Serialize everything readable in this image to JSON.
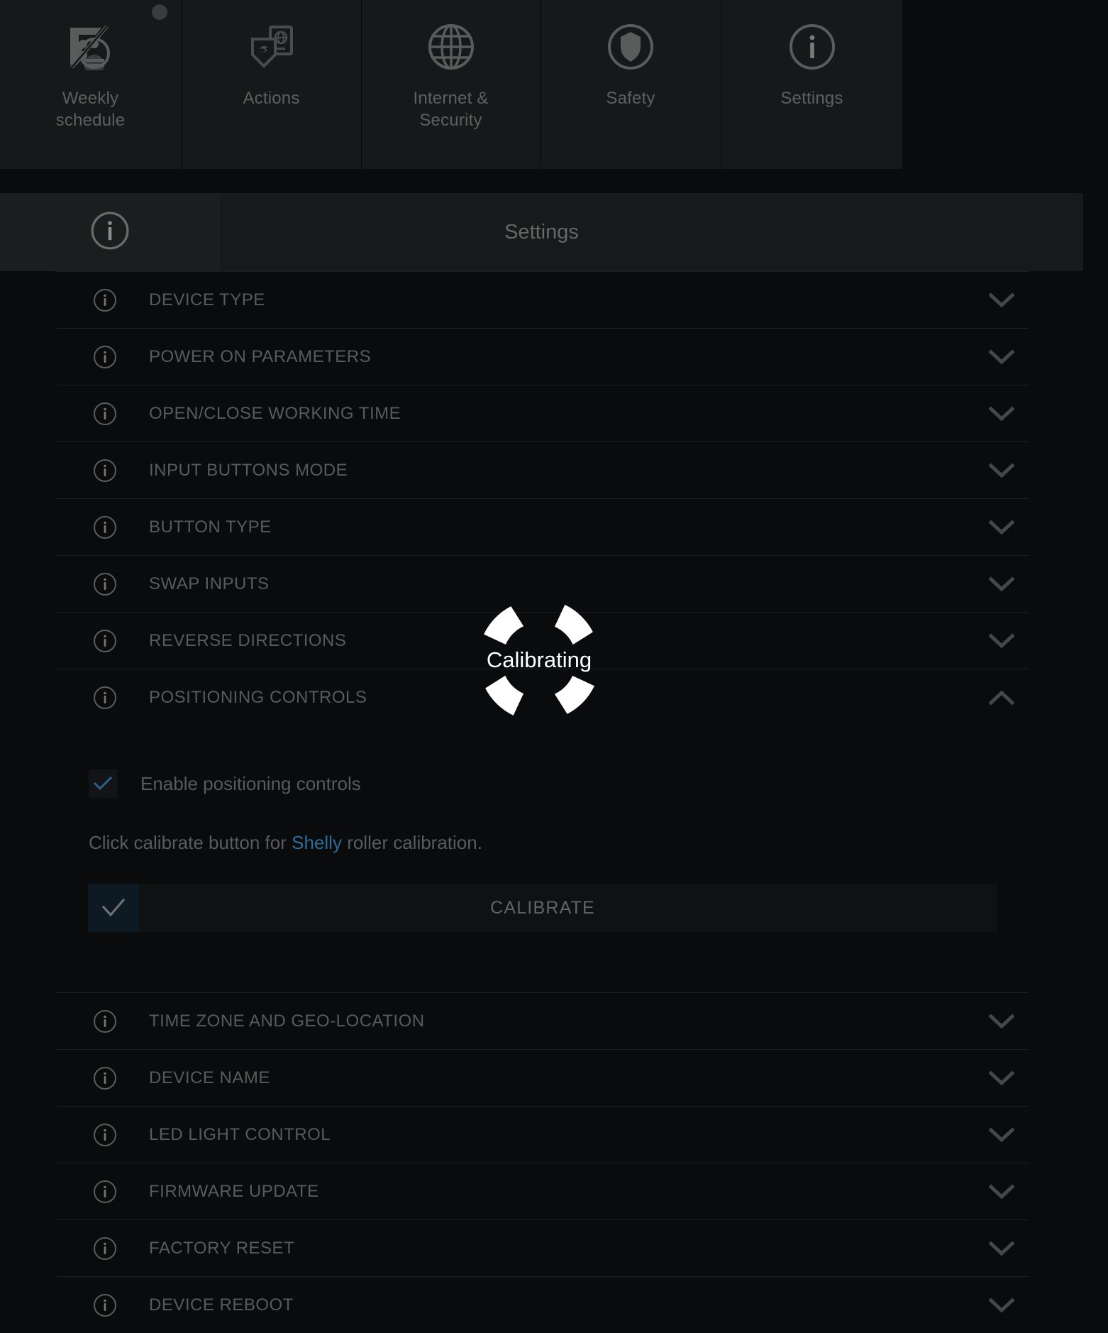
{
  "tabs": [
    {
      "label": "Weekly\nschedule",
      "icon": "weekly-schedule-icon",
      "badge": true
    },
    {
      "label": "Actions",
      "icon": "actions-shield-device-icon",
      "badge": false
    },
    {
      "label": "Internet &\nSecurity",
      "icon": "globe-icon",
      "badge": false
    },
    {
      "label": "Safety",
      "icon": "shield-icon",
      "badge": false
    },
    {
      "label": "Settings",
      "icon": "info-circle-icon",
      "badge": false
    }
  ],
  "section": {
    "icon": "info-circle-icon",
    "title": "Settings"
  },
  "rows": [
    {
      "label": "DEVICE TYPE",
      "chevron": "chevron-down-icon"
    },
    {
      "label": "POWER ON PARAMETERS",
      "chevron": "chevron-down-icon"
    },
    {
      "label": "OPEN/CLOSE WORKING TIME",
      "chevron": "chevron-down-icon"
    },
    {
      "label": "INPUT BUTTONS MODE",
      "chevron": "chevron-down-icon"
    },
    {
      "label": "BUTTON TYPE",
      "chevron": "chevron-down-icon"
    },
    {
      "label": "SWAP INPUTS",
      "chevron": "chevron-down-icon"
    },
    {
      "label": "REVERSE DIRECTIONS",
      "chevron": "chevron-down-icon"
    },
    {
      "label": "POSITIONING CONTROLS",
      "chevron": "chevron-up-icon"
    }
  ],
  "rows_after": [
    {
      "label": "TIME ZONE AND GEO-LOCATION",
      "chevron": "chevron-down-icon"
    },
    {
      "label": "DEVICE NAME",
      "chevron": "chevron-down-icon"
    },
    {
      "label": "LED LIGHT CONTROL",
      "chevron": "chevron-down-icon"
    },
    {
      "label": "FIRMWARE UPDATE",
      "chevron": "chevron-down-icon"
    },
    {
      "label": "FACTORY RESET",
      "chevron": "chevron-down-icon"
    },
    {
      "label": "DEVICE REBOOT",
      "chevron": "chevron-down-icon"
    }
  ],
  "positioning_panel": {
    "checkbox_label": "Enable positioning controls",
    "checkbox_checked": true,
    "hint_before": "Click calibrate button for ",
    "hint_brand": "Shelly",
    "hint_after": " roller calibration.",
    "calibrate_label": "CALIBRATE",
    "calibrate_icon": "check-icon"
  },
  "overlay": {
    "spinner_text": "Calibrating",
    "spinner_icon": "loading-spinner-icon"
  },
  "colors": {
    "page_background": "#0a0b0c",
    "tab_background": "#171819",
    "section_background": "#18191b",
    "divider": "#1d1e20",
    "muted_text": "#595a59",
    "brand_blue": "#2e6c94",
    "checkbox_blue": "#2a5f87",
    "spinner_white": "#ffffff",
    "calibrate_accent": "#0d1a23"
  }
}
